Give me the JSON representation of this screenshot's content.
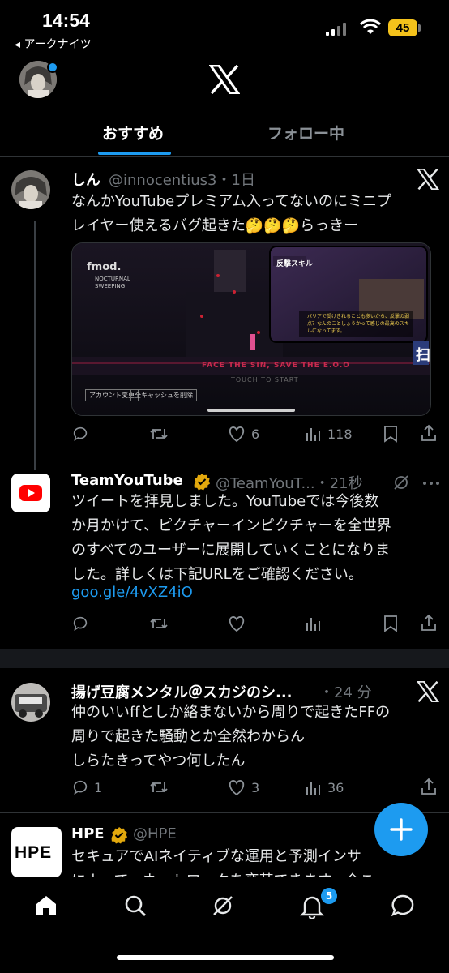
{
  "status": {
    "time": "14:54",
    "back_label": "◂ アークナイツ",
    "battery": "45"
  },
  "tabs": [
    {
      "label": "おすすめ"
    },
    {
      "label": "フォロー中"
    }
  ],
  "tweets": [
    {
      "name": "しん",
      "handle": "@innocentius3・1日",
      "body": "なんかYouTubeプレミアム入ってないのにミニプ\nレイヤー使えるバグ起きた🤔🤔🤔らっきー",
      "media": {
        "brand": "fmod.",
        "tag_title": "反撃スキル",
        "banner": "FACE THE SIN, SAVE THE E.O.O",
        "touch": "TOUCH TO START",
        "btn1": "アカウント変更",
        "btn2": "全キャッシュを削除",
        "big_char": "扫",
        "game_title": "NOCTURNAL SWEEPING",
        "caption": "バリアで受けきれることも多いから、反撃の弱点？なんのことしょうかって感じの最高のスキルになってます。"
      },
      "actions": {
        "replies": "",
        "retweets": "",
        "likes": "6",
        "views": "118"
      }
    },
    {
      "name": "TeamYouTube",
      "handle": "@TeamYouT...・21秒",
      "body": "ツイートを拝見しました。YouTubeでは今後数\nか月かけて、ピクチャーインピクチャーを全世界\nのすべてのユーザーに展開していくことになりま\nした。詳しくは下記URLをご確認ください。",
      "link": "goo.gle/4vXZ4iO",
      "actions": {
        "replies": "",
        "retweets": "",
        "likes": "",
        "views": ""
      }
    },
    {
      "name": "揚げ豆腐メンタル＠スカジのシ...",
      "handle": "・24 分",
      "body": "仲のいいffとしか絡まないから周りで起きたFFの\n周りで起きた騒動とか全然わからん\nしらたきってやつ何したん",
      "actions": {
        "replies": "1",
        "retweets": "",
        "likes": "3",
        "views": "36"
      }
    },
    {
      "name": "HPE",
      "handle": "@HPE",
      "logo": "HPE",
      "body": "セキュアでAIネイティブな運用と予測インサ\nによって、ネットワークを変革できます。今こ"
    }
  ],
  "nav": {
    "notification_count": "5"
  },
  "colors": {
    "accent": "#1d9bf0",
    "background": "#000000",
    "verified": "#e2a80d"
  }
}
